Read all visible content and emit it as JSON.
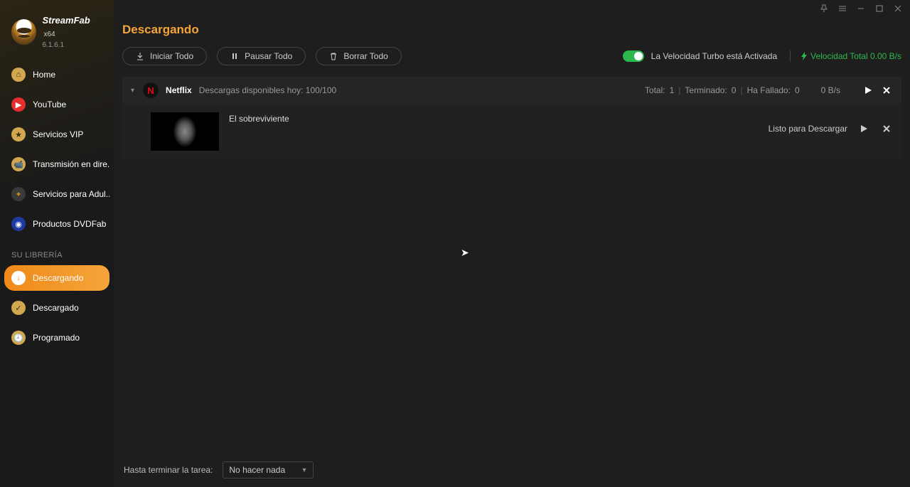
{
  "app": {
    "name": "StreamFab",
    "arch": "x64",
    "version": "6.1.6.1"
  },
  "sidebar": {
    "items": [
      {
        "label": "Home"
      },
      {
        "label": "YouTube"
      },
      {
        "label": "Servicios VIP"
      },
      {
        "label": "Transmisión en dire..."
      },
      {
        "label": "Servicios para Adul..."
      },
      {
        "label": "Productos DVDFab"
      }
    ],
    "section_label": "SU LIBRERÍA",
    "library": [
      {
        "label": "Descargando"
      },
      {
        "label": "Descargado"
      },
      {
        "label": "Programado"
      }
    ]
  },
  "page": {
    "title": "Descargando"
  },
  "toolbar": {
    "start_all": "Iniciar Todo",
    "pause_all": "Pausar Todo",
    "delete_all": "Borrar Todo",
    "turbo_label": "La Velocidad Turbo está Activada",
    "total_speed": "Velocidad Total 0.00 B/s"
  },
  "group": {
    "provider": "Netflix",
    "available": "Descargas disponibles hoy: 100/100",
    "total_label": "Total:",
    "total_value": "1",
    "done_label": "Terminado:",
    "done_value": "0",
    "fail_label": "Ha Fallado:",
    "fail_value": "0",
    "rate": "0 B/s"
  },
  "item": {
    "title": "El sobreviviente",
    "status": "Listo para Descargar"
  },
  "footer": {
    "label": "Hasta terminar la tarea:",
    "option": "No hacer nada"
  }
}
